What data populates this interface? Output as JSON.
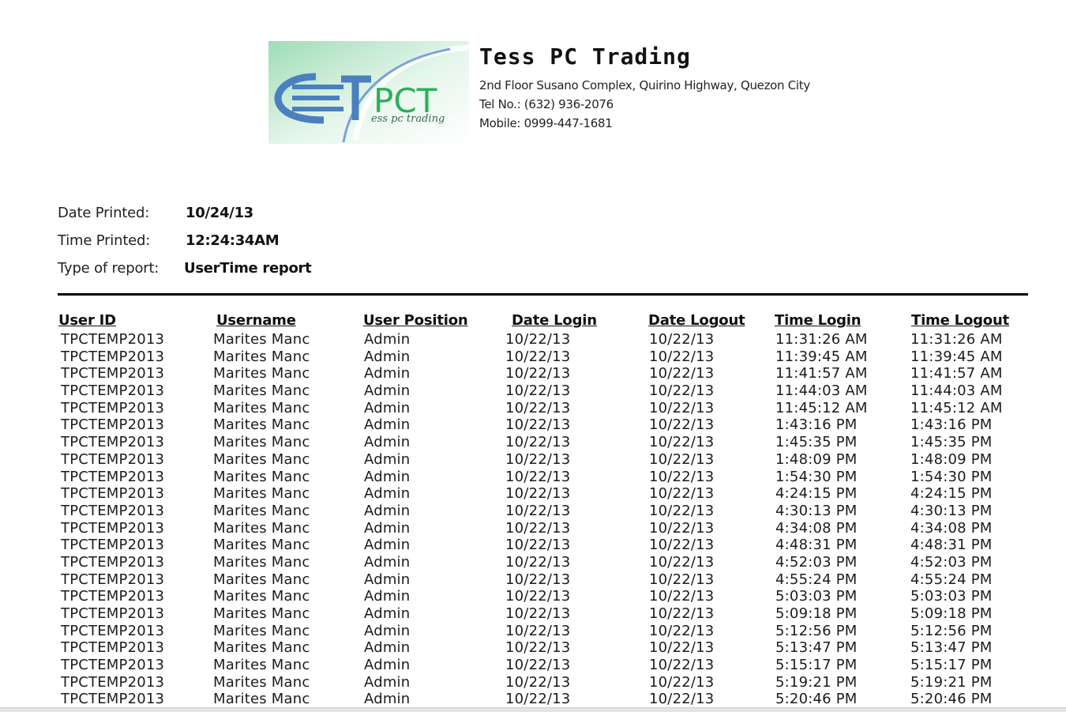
{
  "company": {
    "name": "Tess PC Trading",
    "address": "2nd Floor Susano Complex, Quirino Highway, Quezon City",
    "tel": "Tel No.: (632) 936-2076",
    "mobile": "Mobile: 0999-447-1681",
    "logo_text": "PCT",
    "logo_tagline": "ess pc trading",
    "logo_colors": {
      "green": "#2fae5a",
      "blue": "#4a7fc0",
      "bg": "#d8efe0"
    }
  },
  "meta": {
    "date_label": "Date Printed:",
    "date_value": "10/24/13",
    "time_label": "Time Printed:",
    "time_value": "12:24:34AM",
    "type_label": "Type of report:",
    "type_value": "UserTime report"
  },
  "table": {
    "headers": [
      "User ID",
      "Username",
      "User Position",
      "Date Login",
      "Date Logout",
      "Time Login",
      "Time Logout"
    ],
    "rows": [
      [
        "TPCTEMP2013",
        "Marites  Manc",
        "Admin",
        "10/22/13",
        "10/22/13",
        "11:31:26 AM",
        "11:31:26 AM"
      ],
      [
        "TPCTEMP2013",
        "Marites  Manc",
        "Admin",
        "10/22/13",
        "10/22/13",
        "11:39:45 AM",
        "11:39:45 AM"
      ],
      [
        "TPCTEMP2013",
        "Marites  Manc",
        "Admin",
        "10/22/13",
        "10/22/13",
        "11:41:57 AM",
        "11:41:57 AM"
      ],
      [
        "TPCTEMP2013",
        "Marites  Manc",
        "Admin",
        "10/22/13",
        "10/22/13",
        "11:44:03 AM",
        "11:44:03 AM"
      ],
      [
        "TPCTEMP2013",
        "Marites  Manc",
        "Admin",
        "10/22/13",
        "10/22/13",
        "11:45:12 AM",
        "11:45:12 AM"
      ],
      [
        "TPCTEMP2013",
        "Marites  Manc",
        "Admin",
        "10/22/13",
        "10/22/13",
        "1:43:16 PM",
        "1:43:16 PM"
      ],
      [
        "TPCTEMP2013",
        "Marites  Manc",
        "Admin",
        "10/22/13",
        "10/22/13",
        "1:45:35 PM",
        "1:45:35 PM"
      ],
      [
        "TPCTEMP2013",
        "Marites  Manc",
        "Admin",
        "10/22/13",
        "10/22/13",
        "1:48:09 PM",
        "1:48:09 PM"
      ],
      [
        "TPCTEMP2013",
        "Marites  Manc",
        "Admin",
        "10/22/13",
        "10/22/13",
        "1:54:30 PM",
        "1:54:30 PM"
      ],
      [
        "TPCTEMP2013",
        "Marites  Manc",
        "Admin",
        "10/22/13",
        "10/22/13",
        "4:24:15 PM",
        "4:24:15 PM"
      ],
      [
        "TPCTEMP2013",
        "Marites  Manc",
        "Admin",
        "10/22/13",
        "10/22/13",
        "4:30:13 PM",
        "4:30:13 PM"
      ],
      [
        "TPCTEMP2013",
        "Marites  Manc",
        "Admin",
        "10/22/13",
        "10/22/13",
        "4:34:08 PM",
        "4:34:08 PM"
      ],
      [
        "TPCTEMP2013",
        "Marites  Manc",
        "Admin",
        "10/22/13",
        "10/22/13",
        "4:48:31 PM",
        "4:48:31 PM"
      ],
      [
        "TPCTEMP2013",
        "Marites  Manc",
        "Admin",
        "10/22/13",
        "10/22/13",
        "4:52:03 PM",
        "4:52:03 PM"
      ],
      [
        "TPCTEMP2013",
        "Marites  Manc",
        "Admin",
        "10/22/13",
        "10/22/13",
        "4:55:24 PM",
        "4:55:24 PM"
      ],
      [
        "TPCTEMP2013",
        "Marites  Manc",
        "Admin",
        "10/22/13",
        "10/22/13",
        "5:03:03 PM",
        "5:03:03 PM"
      ],
      [
        "TPCTEMP2013",
        "Marites  Manc",
        "Admin",
        "10/22/13",
        "10/22/13",
        "5:09:18 PM",
        "5:09:18 PM"
      ],
      [
        "TPCTEMP2013",
        "Marites  Manc",
        "Admin",
        "10/22/13",
        "10/22/13",
        "5:12:56 PM",
        "5:12:56 PM"
      ],
      [
        "TPCTEMP2013",
        "Marites  Manc",
        "Admin",
        "10/22/13",
        "10/22/13",
        "5:13:47 PM",
        "5:13:47 PM"
      ],
      [
        "TPCTEMP2013",
        "Marites  Manc",
        "Admin",
        "10/22/13",
        "10/22/13",
        "5:15:17 PM",
        "5:15:17 PM"
      ],
      [
        "TPCTEMP2013",
        "Marites  Manc",
        "Admin",
        "10/22/13",
        "10/22/13",
        "5:19:21 PM",
        "5:19:21 PM"
      ],
      [
        "TPCTEMP2013",
        "Marites  Manc",
        "Admin",
        "10/22/13",
        "10/22/13",
        "5:20:46 PM",
        "5:20:46 PM"
      ]
    ]
  }
}
